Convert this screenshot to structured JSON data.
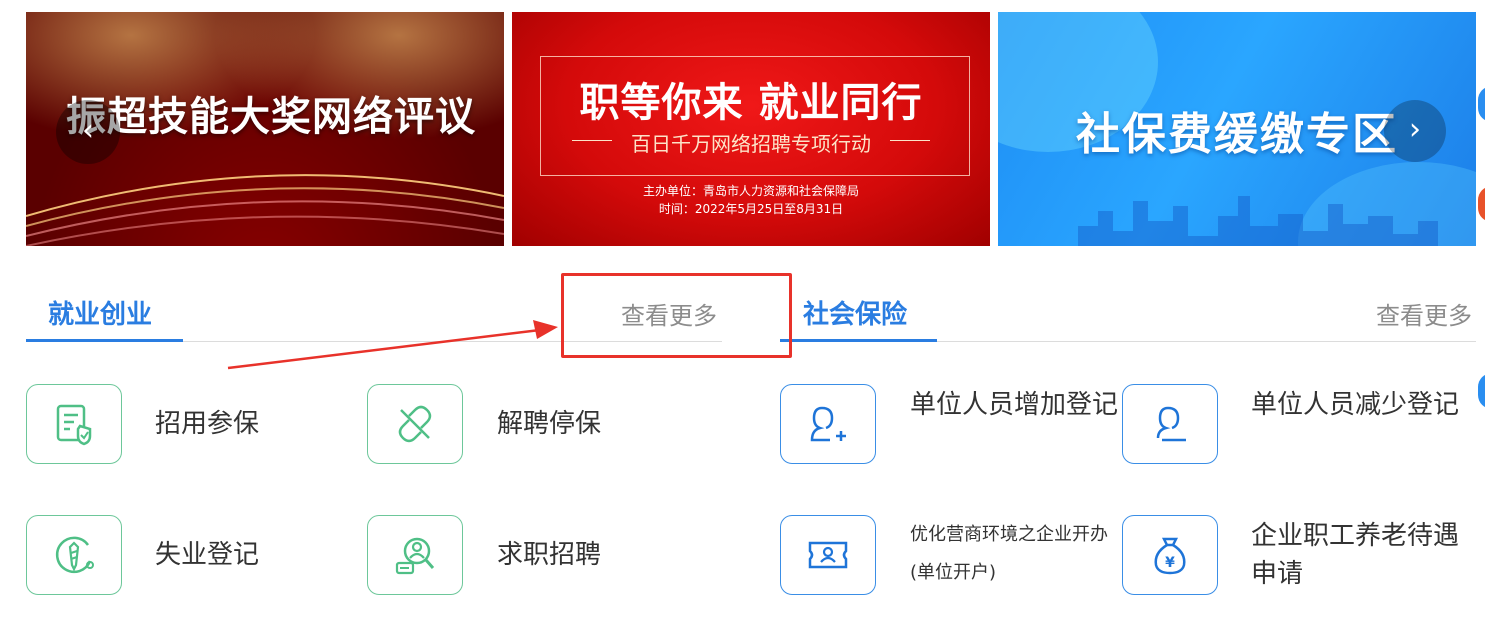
{
  "carousel": {
    "banner1": {
      "title": "振超技能大奖网络评议",
      "prev_arrow": "‹"
    },
    "banner2": {
      "title": "职等你来  就业同行",
      "subtitle": "百日千万网络招聘专项行动",
      "organizer": "主办单位：青岛市人力资源和社会保障局",
      "time": "时间：2022年5月25日至8月31日"
    },
    "banner3": {
      "title": "社保费缓缴专区",
      "next_arrow": "›"
    }
  },
  "employment": {
    "title": "就业创业",
    "more": "查看更多",
    "items": [
      {
        "label": "招用参保",
        "icon": "form-shield-icon"
      },
      {
        "label": "解聘停保",
        "icon": "broken-link-icon"
      },
      {
        "label": "失业登记",
        "icon": "tie-person-icon"
      },
      {
        "label": "求职招聘",
        "icon": "person-search-icon"
      }
    ]
  },
  "insurance": {
    "title": "社会保险",
    "more": "查看更多",
    "items": [
      {
        "label": "单位人员增加登记",
        "icon": "user-add-icon"
      },
      {
        "label": "单位人员减少登记",
        "icon": "user-remove-icon"
      },
      {
        "label_line1": "优化营商环境之企业开办",
        "label_line2": "(单位开户)",
        "icon": "id-card-icon"
      },
      {
        "label_line1": "企业职工养老待遇",
        "label_line2": "申请",
        "icon": "money-bag-icon"
      }
    ]
  },
  "colors": {
    "accent": "#2a7de1",
    "green": "#6dc79a",
    "annotation": "#e8322a"
  }
}
